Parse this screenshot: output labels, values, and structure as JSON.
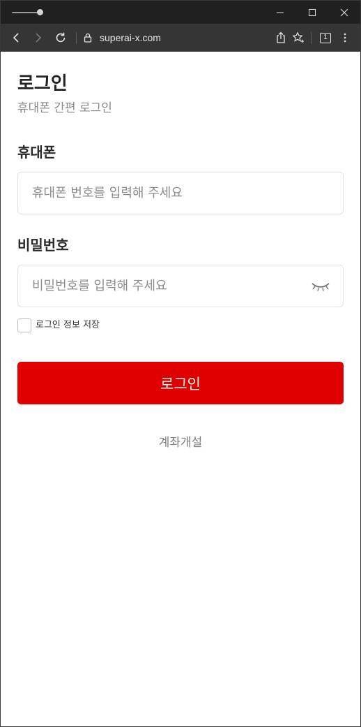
{
  "browser": {
    "url": "superai-x.com",
    "tab_count": "1"
  },
  "login": {
    "title": "로그인",
    "subtitle": "휴대폰 간편 로그인",
    "phone": {
      "label": "휴대폰",
      "placeholder": "휴대폰 번호를 입력해 주세요",
      "value": ""
    },
    "password": {
      "label": "비밀번호",
      "placeholder": "비밀번호를 입력해 주세요",
      "value": ""
    },
    "remember_label": "로그인 정보 저장",
    "remember_checked": false,
    "submit_label": "로그인",
    "open_account_label": "계좌개설"
  },
  "colors": {
    "primary": "#e00000",
    "titlebar": "#202020",
    "toolbar": "#353535"
  },
  "icons": [
    "minimize-icon",
    "maximize-icon",
    "close-icon",
    "back-icon",
    "forward-icon",
    "reload-icon",
    "lock-icon",
    "share-icon",
    "favorite-icon",
    "tab-count-icon",
    "more-icon",
    "eye-closed-icon"
  ]
}
